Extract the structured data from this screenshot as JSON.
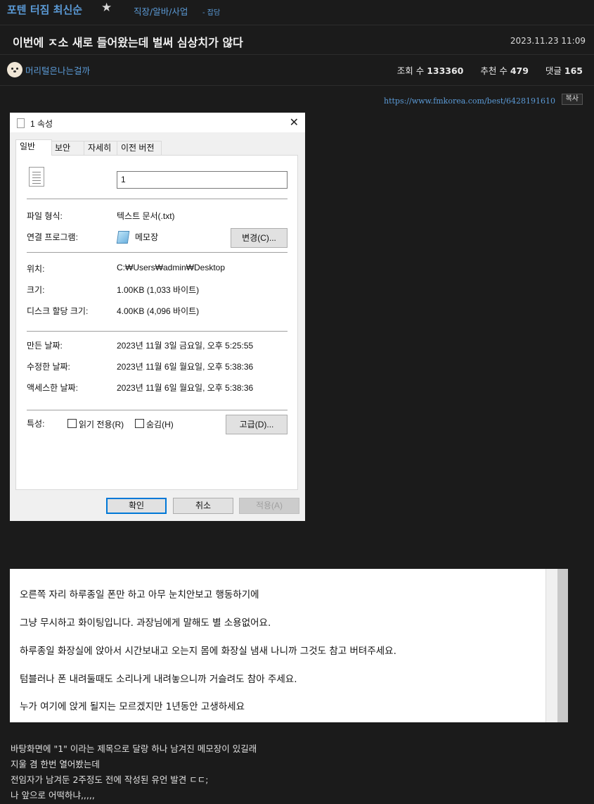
{
  "header": {
    "board_title": "포텐 터짐 최신순",
    "category": "직장/알바/사업",
    "subcategory": "잡담"
  },
  "post": {
    "title": "이번에 ㅈ소 새로 들어왔는데 벌써 심상치가 않다",
    "date": "2023.11.23 11:09",
    "author": "머리털은나는걸까",
    "views_label": "조회 수",
    "views": "133360",
    "recommend_label": "추천 수",
    "recommend": "479",
    "comments_label": "댓글",
    "comments": "165",
    "url": "https://www.fmkorea.com/best/6428191610",
    "copy_label": "복사"
  },
  "dialog": {
    "title": "1 속성",
    "tabs": [
      "일반",
      "보안",
      "자세히",
      "이전 버전"
    ],
    "filename": "1",
    "file_type_label": "파일 형식:",
    "file_type_value": "텍스트 문서(.txt)",
    "open_with_label": "연결 프로그램:",
    "open_with_value": "메모장",
    "change_button": "변경(C)...",
    "location_label": "위치:",
    "location_value": "C:₩Users₩admin₩Desktop",
    "size_label": "크기:",
    "size_value": "1.00KB (1,033 바이트)",
    "disk_size_label": "디스크 할당 크기:",
    "disk_size_value": "4.00KB (4,096 바이트)",
    "created_label": "만든 날짜:",
    "created_value": "2023년 11월 3일 금요일, 오후 5:25:55",
    "modified_label": "수정한 날짜:",
    "modified_value": "2023년 11월 6일 월요일, 오후 5:38:36",
    "accessed_label": "액세스한 날짜:",
    "accessed_value": "2023년 11월 6일 월요일, 오후 5:38:36",
    "attributes_label": "특성:",
    "readonly_label": "읽기 전용(R)",
    "hidden_label": "숨김(H)",
    "advanced_button": "고급(D)...",
    "ok_button": "확인",
    "cancel_button": "취소",
    "apply_button": "적용(A)"
  },
  "notepad_lines": [
    "오른쪽 자리 하루종일 폰만 하고 아무 눈치안보고 행동하기에",
    "그냥 무시하고 화이팅입니다. 과장님에게 말해도 별 소용없어요.",
    "하루종일 화장실에 앉아서 시간보내고 오는지 몸에 화장실 냄새 나니까 그것도 참고 버텨주세요.",
    "텀블러나 폰 내려둘때도 소리나게 내려놓으니까 거슬려도 참아 주세요.",
    "누가 여기에 앉게 될지는 모르겠지만 1년동안 고생하세요"
  ],
  "comment_lines": [
    "바탕화면에 \"1\" 이라는 제목으로 달랑 하나 남겨진 메모장이 있길래",
    "지울 겸 한번 열어봤는데",
    "전임자가 남겨둔 2주정도 전에 작성된 유언 발견 ㄷㄷ;",
    "나 앞으로 어떡하냐,,,,,"
  ]
}
